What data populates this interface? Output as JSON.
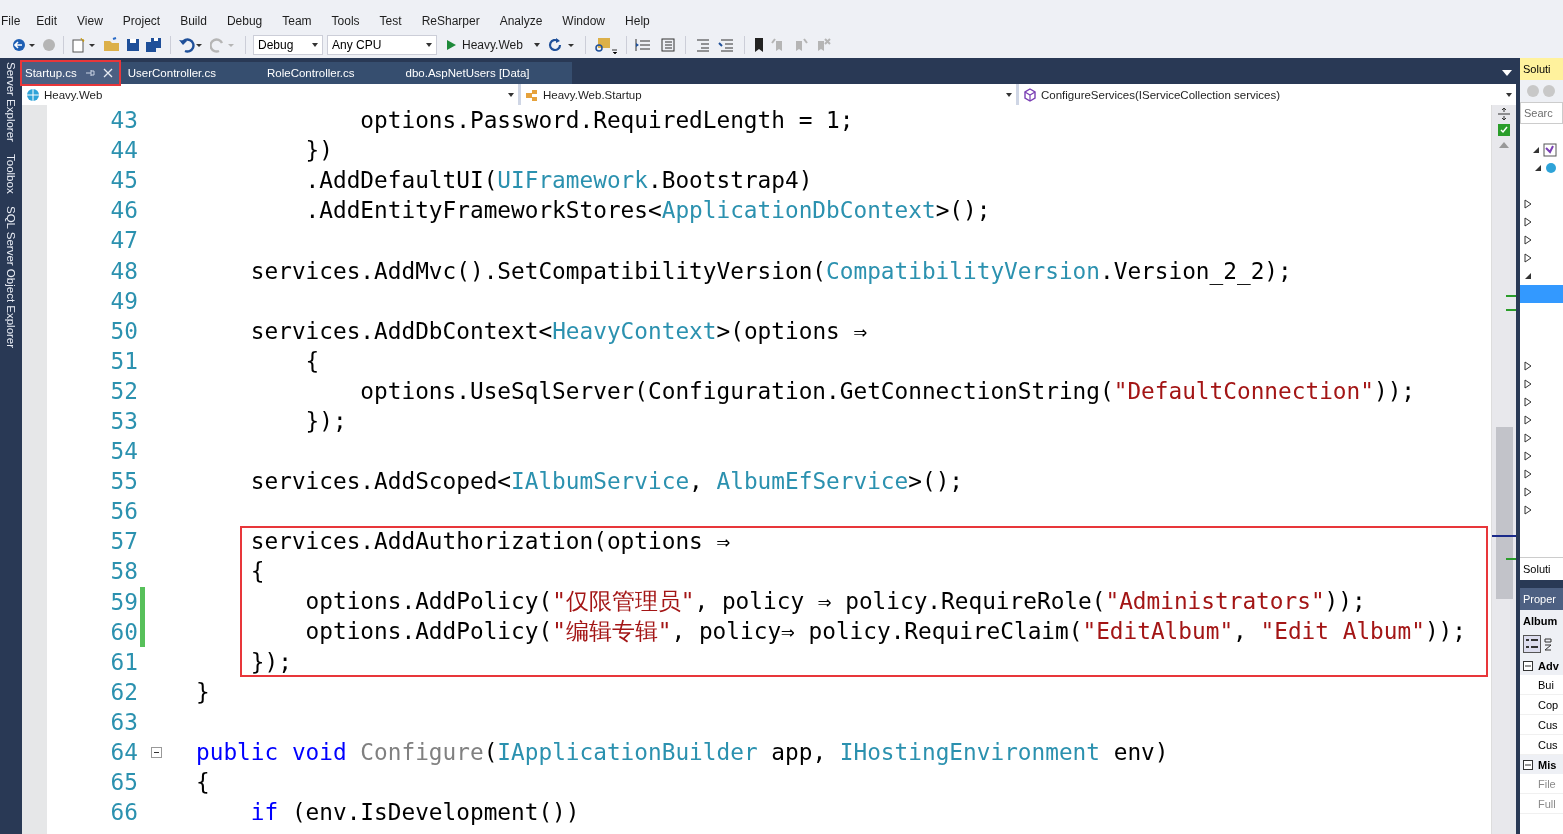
{
  "menu": [
    "File",
    "Edit",
    "View",
    "Project",
    "Build",
    "Debug",
    "Team",
    "Tools",
    "Test",
    "ReSharper",
    "Analyze",
    "Window",
    "Help"
  ],
  "toolbar": {
    "configuration": "Debug",
    "platform": "Any CPU",
    "start_target": "Heavy.Web"
  },
  "side_tabs": [
    "Server Explorer",
    "Toolbox",
    "SQL Server Object Explorer"
  ],
  "tabs": [
    {
      "label": "Startup.cs",
      "selected": true,
      "highlighted": true
    },
    {
      "label": "UserController.cs",
      "selected": false,
      "highlighted": false
    },
    {
      "label": "RoleController.cs",
      "selected": false,
      "highlighted": false
    },
    {
      "label": "dbo.AspNetUsers [Data]",
      "selected": false,
      "highlighted": false
    }
  ],
  "nav_bar": {
    "project": "Heavy.Web",
    "type": "Heavy.Web.Startup",
    "member": "ConfigureServices(IServiceCollection services)"
  },
  "code_lines": [
    {
      "number": "43",
      "tokens": [
        {
          "kind": "plain",
          "text": "            options.Password.RequiredLength = 1;"
        }
      ]
    },
    {
      "number": "44",
      "tokens": [
        {
          "kind": "plain",
          "text": "        })"
        }
      ]
    },
    {
      "number": "45",
      "tokens": [
        {
          "kind": "plain",
          "text": "        .AddDefaultUI("
        },
        {
          "kind": "type",
          "text": "UIFramework"
        },
        {
          "kind": "plain",
          "text": ".Bootstrap4)"
        }
      ]
    },
    {
      "number": "46",
      "tokens": [
        {
          "kind": "plain",
          "text": "        .AddEntityFrameworkStores<"
        },
        {
          "kind": "type",
          "text": "ApplicationDbContext"
        },
        {
          "kind": "plain",
          "text": ">();"
        }
      ]
    },
    {
      "number": "47"
    },
    {
      "number": "48",
      "tokens": [
        {
          "kind": "plain",
          "text": "    services.AddMvc().SetCompatibilityVersion("
        },
        {
          "kind": "type",
          "text": "CompatibilityVersion"
        },
        {
          "kind": "plain",
          "text": ".Version_2_2);"
        }
      ]
    },
    {
      "number": "49"
    },
    {
      "number": "50",
      "tokens": [
        {
          "kind": "plain",
          "text": "    services.AddDbContext<"
        },
        {
          "kind": "type",
          "text": "HeavyContext"
        },
        {
          "kind": "plain",
          "text": ">(options ⇒"
        }
      ]
    },
    {
      "number": "51",
      "tokens": [
        {
          "kind": "plain",
          "text": "        {"
        }
      ]
    },
    {
      "number": "52",
      "tokens": [
        {
          "kind": "plain",
          "text": "            options.UseSqlServer(Configuration.GetConnectionString("
        },
        {
          "kind": "string",
          "text": "\"DefaultConnection\""
        },
        {
          "kind": "plain",
          "text": "));"
        }
      ]
    },
    {
      "number": "53",
      "tokens": [
        {
          "kind": "plain",
          "text": "        });"
        }
      ]
    },
    {
      "number": "54"
    },
    {
      "number": "55",
      "tokens": [
        {
          "kind": "plain",
          "text": "    services.AddScoped<"
        },
        {
          "kind": "type",
          "text": "IAlbumService"
        },
        {
          "kind": "plain",
          "text": ", "
        },
        {
          "kind": "type",
          "text": "AlbumEfService"
        },
        {
          "kind": "plain",
          "text": ">();"
        }
      ]
    },
    {
      "number": "56"
    },
    {
      "number": "57",
      "highlighted": true,
      "tokens": [
        {
          "kind": "plain",
          "text": "    services.AddAuthorization(options ⇒"
        }
      ]
    },
    {
      "number": "58",
      "highlighted": true,
      "tokens": [
        {
          "kind": "plain",
          "text": "    {"
        }
      ]
    },
    {
      "number": "59",
      "highlighted": true,
      "changed": true,
      "tokens": [
        {
          "kind": "plain",
          "text": "        options.AddPolicy("
        },
        {
          "kind": "string",
          "text": "\"仅限管理员\""
        },
        {
          "kind": "plain",
          "text": ", policy ⇒ policy.RequireRole("
        },
        {
          "kind": "string",
          "text": "\"Administrators\""
        },
        {
          "kind": "plain",
          "text": "));"
        }
      ]
    },
    {
      "number": "60",
      "highlighted": true,
      "changed": true,
      "tokens": [
        {
          "kind": "plain",
          "text": "        options.AddPolicy("
        },
        {
          "kind": "string",
          "text": "\"编辑专辑\""
        },
        {
          "kind": "plain",
          "text": ", policy⇒ policy.RequireClaim("
        },
        {
          "kind": "string",
          "text": "\"EditAlbum\""
        },
        {
          "kind": "plain",
          "text": ", "
        },
        {
          "kind": "string",
          "text": "\"Edit Album\""
        },
        {
          "kind": "plain",
          "text": "));"
        }
      ]
    },
    {
      "number": "61",
      "highlighted": true,
      "tokens": [
        {
          "kind": "plain",
          "text": "    });"
        }
      ]
    },
    {
      "number": "62",
      "tokens": [
        {
          "kind": "plain",
          "text": "}"
        }
      ]
    },
    {
      "number": "63"
    },
    {
      "number": "64",
      "collapsible": true,
      "tokens": [
        {
          "kind": "keyword",
          "text": "public"
        },
        {
          "kind": "keyword",
          "text": " void"
        },
        {
          "kind": "unused",
          "text": " Configure"
        },
        {
          "kind": "plain",
          "text": "("
        },
        {
          "kind": "type",
          "text": "IApplicationBuilder"
        },
        {
          "kind": "plain",
          "text": " app, "
        },
        {
          "kind": "type",
          "text": "IHostingEnvironment"
        },
        {
          "kind": "plain",
          "text": " env)"
        }
      ]
    },
    {
      "number": "65",
      "tokens": [
        {
          "kind": "plain",
          "text": "{"
        }
      ]
    },
    {
      "number": "66",
      "tokens": [
        {
          "kind": "keyword",
          "text": "    if"
        },
        {
          "kind": "plain",
          "text": " (env.IsDevelopment())"
        }
      ]
    }
  ],
  "solution_explorer": {
    "title": "Soluti",
    "search_placeholder": "Searc",
    "footer_tab": "Soluti",
    "tree": [
      {
        "kind": "solution",
        "expanded": true,
        "selected": false,
        "children": [
          {
            "kind": "project",
            "expanded": true,
            "selected": false,
            "children": [
              {
                "selected": false
              },
              {
                "expanded": false,
                "selected": false
              },
              {
                "expanded": false,
                "selected": false
              },
              {
                "expanded": false,
                "selected": false
              },
              {
                "expanded": false,
                "selected": false
              },
              {
                "expanded": true,
                "selected": false,
                "children": [
                  {
                    "selected": true
                  },
                  {
                    "selected": false
                  },
                  {
                    "selected": false
                  },
                  {
                    "selected": false
                  }
                ]
              },
              {
                "expanded": false,
                "selected": false
              },
              {
                "expanded": false,
                "selected": false
              },
              {
                "expanded": false,
                "selected": false
              },
              {
                "expanded": false,
                "selected": false
              },
              {
                "expanded": false,
                "selected": false
              },
              {
                "expanded": false,
                "selected": false
              },
              {
                "expanded": false,
                "selected": false
              },
              {
                "expanded": false,
                "selected": false
              },
              {
                "expanded": false,
                "selected": false
              }
            ]
          }
        ]
      }
    ]
  },
  "properties": {
    "title": "Proper",
    "object": "Album",
    "groups": [
      {
        "label": "Adv",
        "expanded": true,
        "rows": [
          {
            "label": "Bui",
            "readonly": false
          },
          {
            "label": "Cop",
            "readonly": false
          },
          {
            "label": "Cus",
            "readonly": false
          },
          {
            "label": "Cus",
            "readonly": false
          }
        ]
      },
      {
        "label": "Mis",
        "expanded": true,
        "rows": [
          {
            "label": "File",
            "readonly": true
          },
          {
            "label": "Full",
            "readonly": true
          }
        ]
      }
    ]
  }
}
